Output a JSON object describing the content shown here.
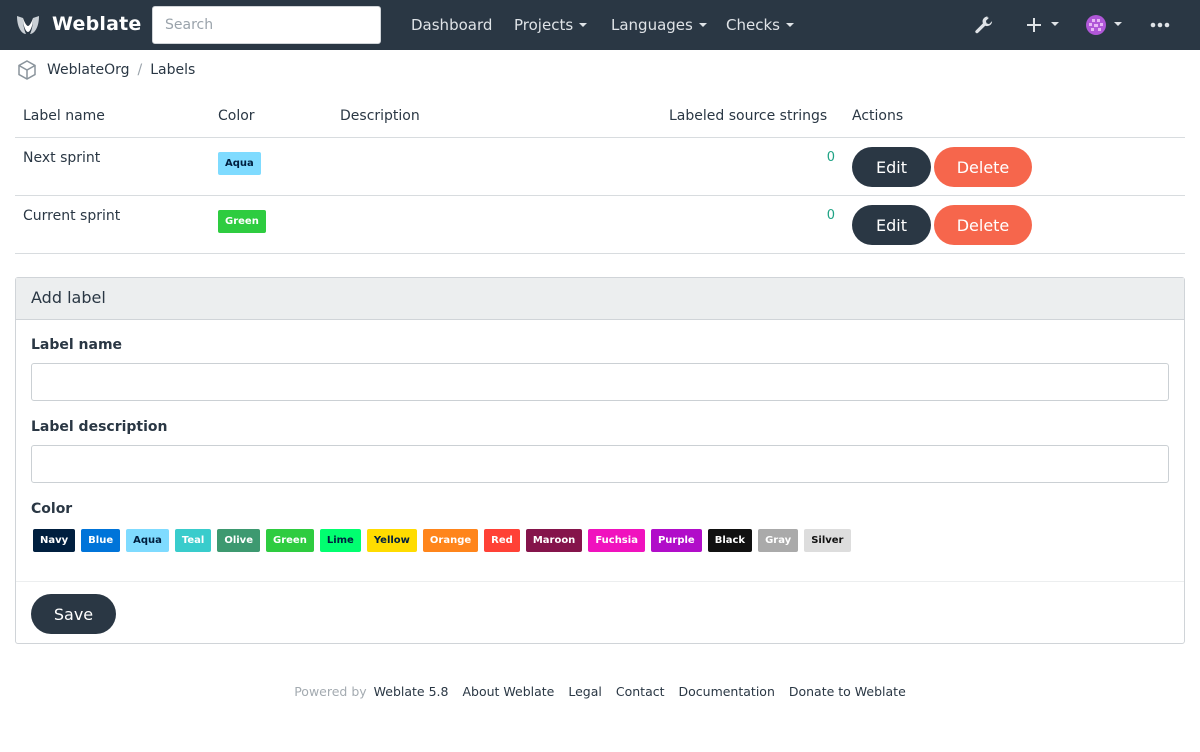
{
  "navbar": {
    "brand": "Weblate",
    "search_placeholder": "Search",
    "links": [
      "Dashboard",
      "Projects",
      "Languages",
      "Checks"
    ]
  },
  "breadcrumb": {
    "org": "WeblateOrg",
    "page": "Labels"
  },
  "table": {
    "headers": [
      "Label name",
      "Color",
      "Description",
      "Labeled source strings",
      "Actions"
    ],
    "rows": [
      {
        "name": "Next sprint",
        "color": "Aqua",
        "color_hex": "#7fdbff",
        "description": "",
        "count": "0"
      },
      {
        "name": "Current sprint",
        "color": "Green",
        "color_hex": "#2ecc40",
        "description": "",
        "count": "0"
      }
    ],
    "edit_label": "Edit",
    "delete_label": "Delete"
  },
  "form": {
    "title": "Add label",
    "name_label": "Label name",
    "description_label": "Label description",
    "color_label": "Color",
    "colors": [
      {
        "name": "Navy",
        "bg": "#001f3f",
        "fg": "#ffffff"
      },
      {
        "name": "Blue",
        "bg": "#0074d9",
        "fg": "#ffffff"
      },
      {
        "name": "Aqua",
        "bg": "#7fdbff",
        "fg": "#001f3f"
      },
      {
        "name": "Teal",
        "bg": "#39cccc",
        "fg": "#ffffff"
      },
      {
        "name": "Olive",
        "bg": "#3d9970",
        "fg": "#ffffff"
      },
      {
        "name": "Green",
        "bg": "#2ecc40",
        "fg": "#ffffff"
      },
      {
        "name": "Lime",
        "bg": "#01ff70",
        "fg": "#001f3f"
      },
      {
        "name": "Yellow",
        "bg": "#ffdc00",
        "fg": "#001f3f"
      },
      {
        "name": "Orange",
        "bg": "#ff851b",
        "fg": "#ffffff"
      },
      {
        "name": "Red",
        "bg": "#ff4136",
        "fg": "#ffffff"
      },
      {
        "name": "Maroon",
        "bg": "#85144b",
        "fg": "#ffffff"
      },
      {
        "name": "Fuchsia",
        "bg": "#f012be",
        "fg": "#ffffff"
      },
      {
        "name": "Purple",
        "bg": "#b10dc9",
        "fg": "#ffffff"
      },
      {
        "name": "Black",
        "bg": "#111111",
        "fg": "#ffffff"
      },
      {
        "name": "Gray",
        "bg": "#aaaaaa",
        "fg": "#ffffff"
      },
      {
        "name": "Silver",
        "bg": "#dddddd",
        "fg": "#111111"
      }
    ],
    "save_label": "Save"
  },
  "footer": {
    "powered_by": "Powered by",
    "links": [
      "Weblate 5.8",
      "About Weblate",
      "Legal",
      "Contact",
      "Documentation",
      "Donate to Weblate"
    ]
  }
}
